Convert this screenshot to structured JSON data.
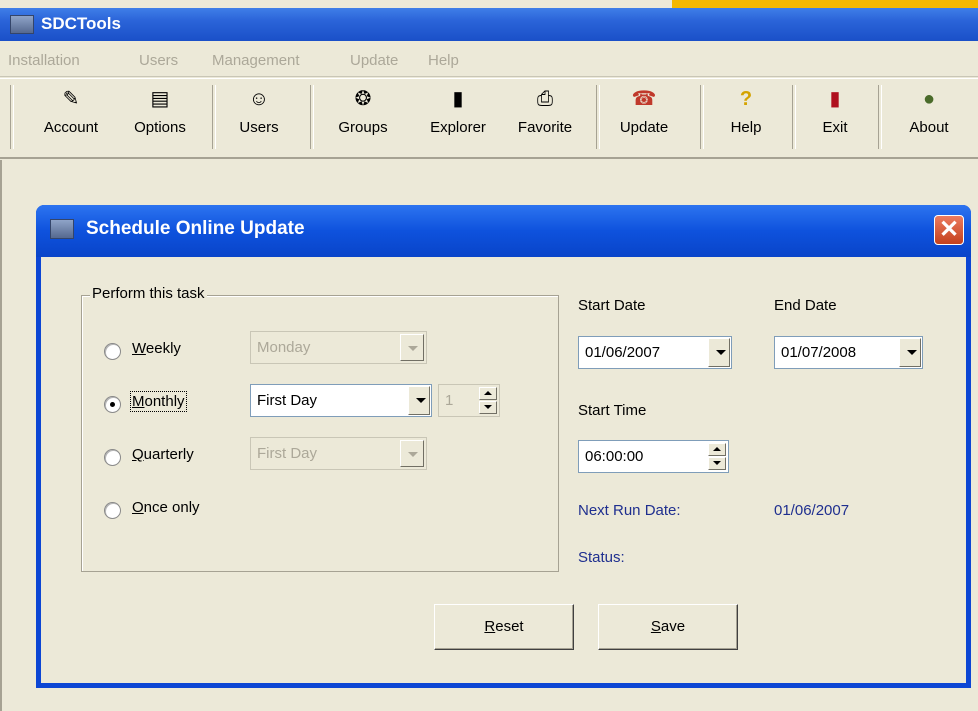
{
  "app": {
    "title": "SDCTools"
  },
  "menu": [
    "Installation",
    "Users",
    "Management",
    "Update",
    "Help"
  ],
  "toolbar": [
    {
      "label": "Account",
      "icon": "account-icon"
    },
    {
      "label": "Options",
      "icon": "printer-icon"
    },
    {
      "label": "Users",
      "icon": "users-icon"
    },
    {
      "label": "Groups",
      "icon": "groups-icon"
    },
    {
      "label": "Explorer",
      "icon": "explorer-icon"
    },
    {
      "label": "Favorite",
      "icon": "favorite-icon"
    },
    {
      "label": "Update",
      "icon": "phone-icon"
    },
    {
      "label": "Help",
      "icon": "question-icon"
    },
    {
      "label": "Exit",
      "icon": "door-icon"
    },
    {
      "label": "About",
      "icon": "globe-icon"
    }
  ],
  "dialog": {
    "title": "Schedule Online Update",
    "group_label": "Perform this task",
    "options": {
      "weekly": {
        "label_key": "W",
        "label_rest": "eekly",
        "select": "Monday",
        "checked": false
      },
      "monthly": {
        "label_key": "M",
        "label_rest": "onthly",
        "select": "First Day",
        "spin": "1",
        "checked": true
      },
      "quarterly": {
        "label_key": "Q",
        "label_rest": "uarterly",
        "select": "First Day",
        "checked": false
      },
      "once": {
        "label_key": "O",
        "label_rest": "nce only",
        "checked": false
      }
    },
    "start_date_label": "Start Date",
    "start_date": "01/06/2007",
    "end_date_label": "End Date",
    "end_date": "01/07/2008",
    "start_time_label": "Start Time",
    "start_time": "06:00:00",
    "next_run_label": "Next Run Date:",
    "next_run_value": "01/06/2007",
    "status_label": "Status:",
    "reset": {
      "key": "R",
      "rest": "eset"
    },
    "save": {
      "key": "S",
      "rest": "ave"
    }
  },
  "colors": {
    "titlebar": "#2a63d8",
    "dialog_border": "#0c46d4",
    "window_bg": "#ece9d8",
    "info_text": "#1f2f8f",
    "accent_strip": "#f5b800"
  }
}
